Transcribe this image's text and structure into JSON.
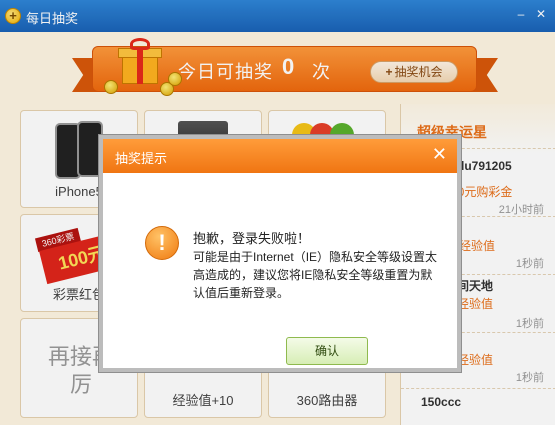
{
  "window": {
    "title": "每日抽奖",
    "minimize_glyph": "–",
    "close_glyph": "✕"
  },
  "banner": {
    "text": "今日可抽奖",
    "count": "0",
    "unit": "次",
    "chance_button": "抽奖机会"
  },
  "prizes": [
    {
      "label": "iPhone5",
      "icon": "phone-icon"
    },
    {
      "label": "",
      "icon": "printer-icon"
    },
    {
      "label": "",
      "icon": "lottery-balls-icon"
    },
    {
      "label": "彩票红包",
      "icon": "lottery-ticket-icon",
      "badge": "360彩票",
      "amount": "100元"
    },
    {
      "label": "",
      "icon": "empty"
    },
    {
      "label": "",
      "icon": "empty"
    },
    {
      "label": "再接再厉",
      "icon": "none"
    },
    {
      "label": "经验值+10",
      "icon": "exp-icon"
    },
    {
      "label": "360路由器",
      "icon": "router-icon"
    }
  ],
  "ranking": {
    "title": "超级幸运星",
    "entries": [
      {
        "name": "lu791205",
        "prize": "00元购彩金",
        "time": "21小时前"
      },
      {
        "name": "",
        "prize": "经验值",
        "time": "1秒前"
      },
      {
        "name": "间天地",
        "prize": "经验值",
        "time": "1秒前"
      },
      {
        "name": "",
        "prize": "经验值",
        "time": "1秒前"
      },
      {
        "name": "150ccc",
        "prize": "",
        "time": ""
      }
    ]
  },
  "dialog": {
    "title": "抽奖提示",
    "close_glyph": "✕",
    "message_title": "抱歉，登录失败啦！",
    "message_body": "可能是由于Internet（IE）隐私安全等级设置太高造成的，建议您将IE隐私安全等级重置为默认值后重新登录。",
    "ok_label": "确认"
  },
  "colors": {
    "accent": "#f07512",
    "titlebar": "#1a63b8",
    "ok_button": "#d7eeb5"
  }
}
